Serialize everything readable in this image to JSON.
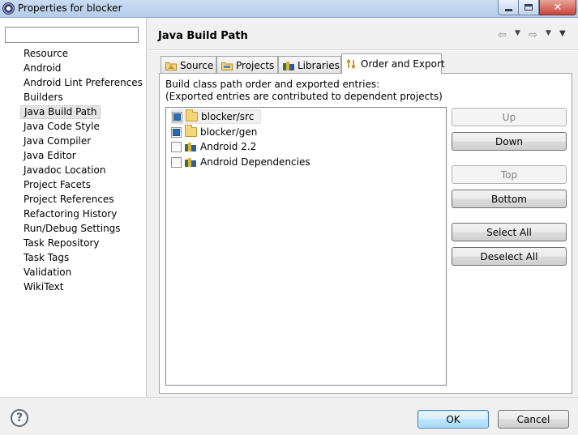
{
  "window": {
    "title": "Properties for blocker",
    "caption_buttons": {
      "minimize": "minimize-icon",
      "maximize": "maximize-icon",
      "close": "✕"
    }
  },
  "filter": {
    "value": "",
    "placeholder": ""
  },
  "nav": {
    "items": [
      "Resource",
      "Android",
      "Android Lint Preferences",
      "Builders",
      "Java Build Path",
      "Java Code Style",
      "Java Compiler",
      "Java Editor",
      "Javadoc Location",
      "Project Facets",
      "Project References",
      "Refactoring History",
      "Run/Debug Settings",
      "Task Repository",
      "Task Tags",
      "Validation",
      "WikiText"
    ],
    "selected_index": 4
  },
  "page": {
    "title": "Java Build Path",
    "nav_icons": [
      "back-arrow-icon",
      "forward-arrow-icon",
      "view-menu-icon"
    ]
  },
  "tabs": [
    {
      "label": "Source",
      "icon": "source-folder-icon",
      "active": false
    },
    {
      "label": "Projects",
      "icon": "projects-folder-icon",
      "active": false
    },
    {
      "label": "Libraries",
      "icon": "libraries-icon",
      "active": false
    },
    {
      "label": "Order and Export",
      "icon": "order-export-icon",
      "active": true
    }
  ],
  "order_export": {
    "description_line1": "Build class path order and exported entries:",
    "description_line2": "(Exported entries are contributed to dependent projects)",
    "entries": [
      {
        "label": "blocker/src",
        "checked": true,
        "icon": "folder-icon"
      },
      {
        "label": "blocker/gen",
        "checked": true,
        "icon": "folder-icon"
      },
      {
        "label": "Android 2.2",
        "checked": false,
        "icon": "library-icon"
      },
      {
        "label": "Android Dependencies",
        "checked": false,
        "icon": "library-icon"
      }
    ],
    "buttons": {
      "up": "Up",
      "down": "Down",
      "top": "Top",
      "bottom": "Bottom",
      "select_all": "Select All",
      "deselect_all": "Deselect All"
    }
  },
  "footer": {
    "help_icon": "?",
    "ok": "OK",
    "cancel": "Cancel"
  },
  "colors": {
    "titlebar": "#c9dcf2",
    "selected_nav": "#e5e5e5",
    "checkbox_fill": "#2a6fb0",
    "ok_border": "#3c7fb1"
  }
}
